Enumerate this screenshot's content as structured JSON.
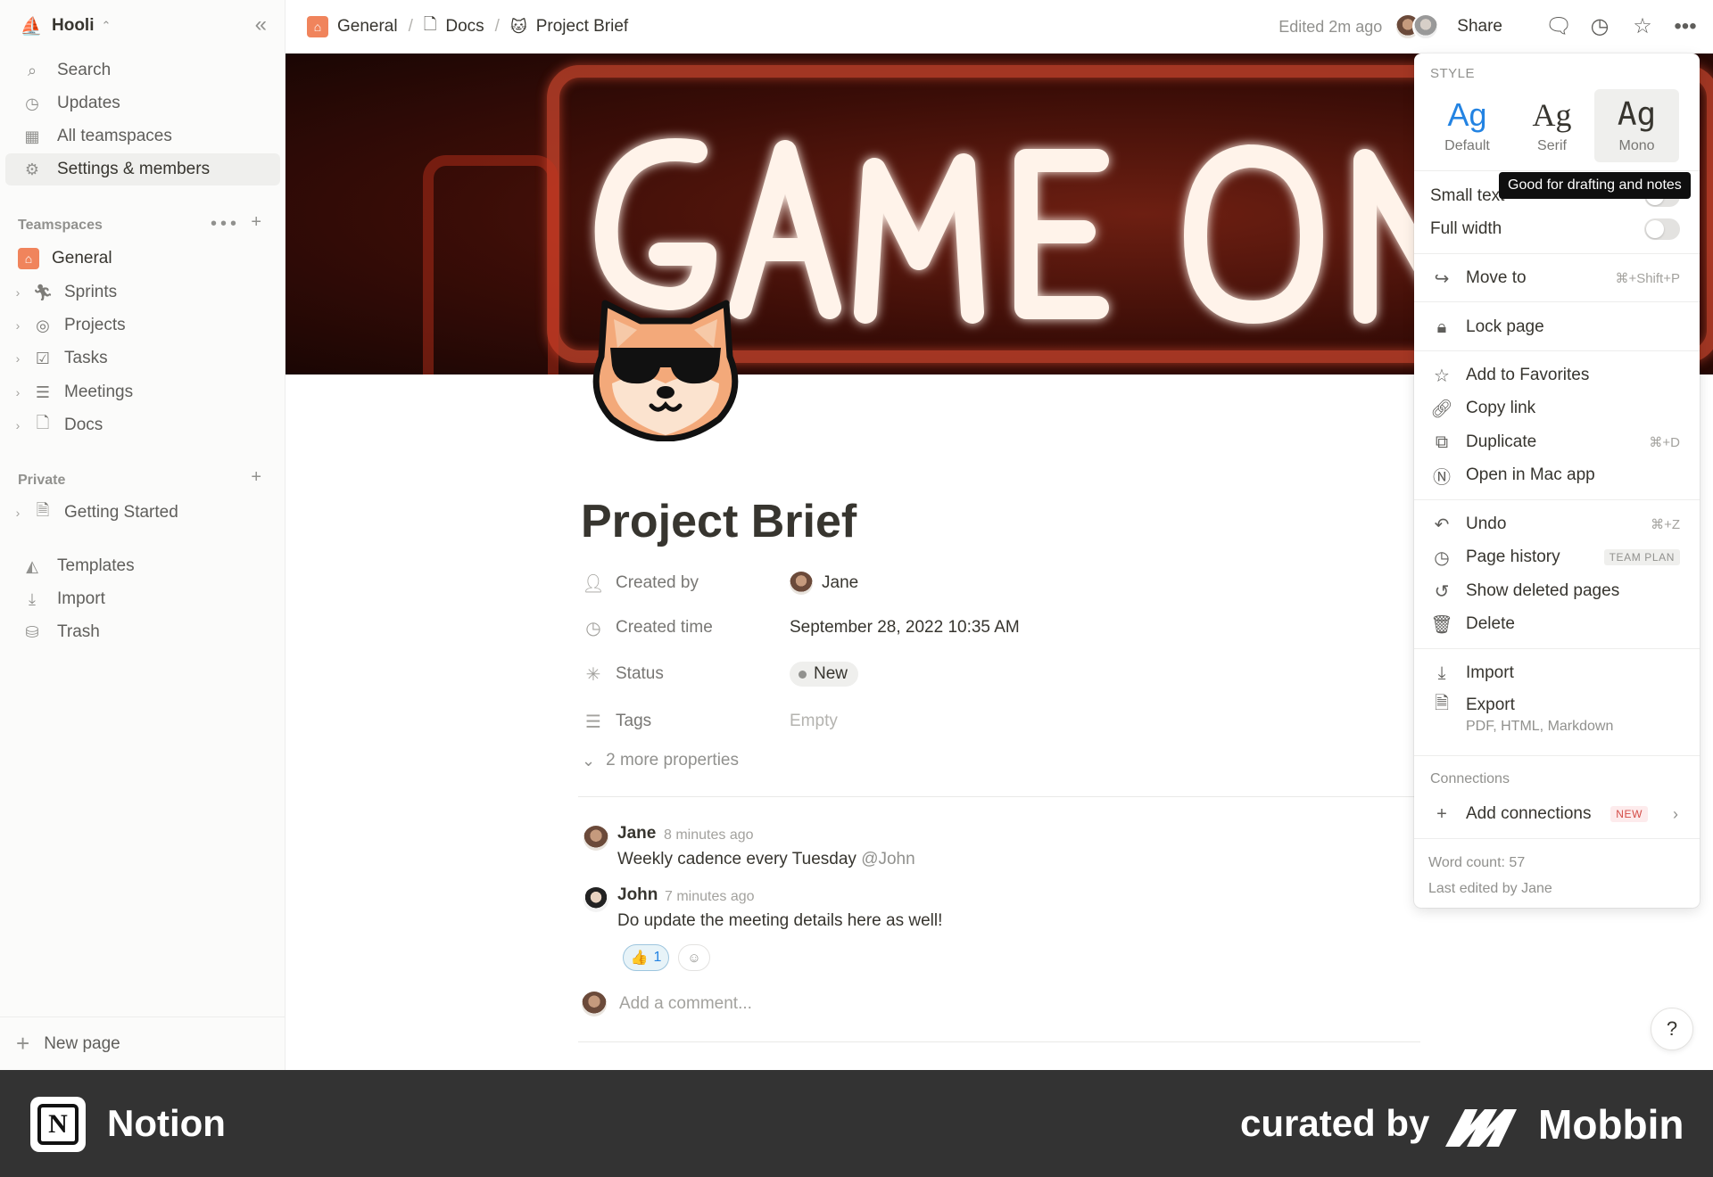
{
  "workspace": {
    "name": "Hooli"
  },
  "sidebar": {
    "top_items": [
      {
        "label": "Search",
        "icon": "search-icon"
      },
      {
        "label": "Updates",
        "icon": "clock-icon"
      },
      {
        "label": "All teamspaces",
        "icon": "building-icon"
      },
      {
        "label": "Settings & members",
        "icon": "gear-icon"
      }
    ],
    "teamspaces_label": "Teamspaces",
    "teamspaces": [
      {
        "label": "General",
        "icon": "home-icon"
      },
      {
        "label": "Sprints",
        "icon": "runner-icon"
      },
      {
        "label": "Projects",
        "icon": "target-icon"
      },
      {
        "label": "Tasks",
        "icon": "checkbox-icon"
      },
      {
        "label": "Meetings",
        "icon": "list-icon"
      },
      {
        "label": "Docs",
        "icon": "doc-icon"
      }
    ],
    "private_label": "Private",
    "private": [
      {
        "label": "Getting Started",
        "icon": "doc-icon"
      }
    ],
    "bottom_items": [
      {
        "label": "Templates",
        "icon": "templates-icon"
      },
      {
        "label": "Import",
        "icon": "download-icon"
      },
      {
        "label": "Trash",
        "icon": "trash-icon"
      }
    ],
    "new_page": "New page"
  },
  "topbar": {
    "breadcrumbs": [
      "General",
      "Docs",
      "Project Brief"
    ],
    "separator": "/",
    "edited": "Edited 2m ago",
    "share": "Share"
  },
  "page": {
    "title": "Project Brief",
    "properties": [
      {
        "name": "Created by",
        "value": "Jane",
        "icon": "person-icon"
      },
      {
        "name": "Created time",
        "value": "September 28, 2022 10:35 AM",
        "icon": "clock-icon"
      },
      {
        "name": "Status",
        "value": "New",
        "icon": "status-icon"
      },
      {
        "name": "Tags",
        "value": "Empty",
        "icon": "list-icon"
      }
    ],
    "more_properties": "2 more properties",
    "comments": [
      {
        "author": "Jane",
        "time": "8 minutes ago",
        "text": "Weekly cadence every Tuesday",
        "mention": "@John"
      },
      {
        "author": "John",
        "time": "7 minutes ago",
        "text": "Do update the meeting details here as well!",
        "reaction_count": "1",
        "reaction_emoji": "👍"
      }
    ],
    "add_comment_placeholder": "Add a comment...",
    "help": "?"
  },
  "menu": {
    "style_label": "STYLE",
    "styles": [
      {
        "glyph": "Ag",
        "label": "Default"
      },
      {
        "glyph": "Ag",
        "label": "Serif"
      },
      {
        "glyph": "Ag",
        "label": "Mono"
      }
    ],
    "tooltip": "Good for drafting and notes",
    "small_text": "Small text",
    "full_width": "Full width",
    "move_to": {
      "label": "Move to",
      "shortcut": "⌘+Shift+P"
    },
    "lock_page": "Lock page",
    "add_favorites": "Add to Favorites",
    "copy_link": "Copy link",
    "duplicate": {
      "label": "Duplicate",
      "shortcut": "⌘+D"
    },
    "open_mac": "Open in Mac app",
    "undo": {
      "label": "Undo",
      "shortcut": "⌘+Z"
    },
    "page_history": {
      "label": "Page history",
      "badge": "TEAM PLAN"
    },
    "show_deleted": "Show deleted pages",
    "delete": "Delete",
    "import": "Import",
    "export": {
      "label": "Export",
      "sub": "PDF, HTML, Markdown"
    },
    "connections_label": "Connections",
    "add_connections": {
      "label": "Add connections",
      "badge": "NEW"
    },
    "word_count": "Word count: 57",
    "last_edited": "Last edited by Jane"
  },
  "brand": {
    "app": "Notion",
    "curated": "curated by",
    "curator": "Mobbin",
    "logo_letter": "N"
  }
}
